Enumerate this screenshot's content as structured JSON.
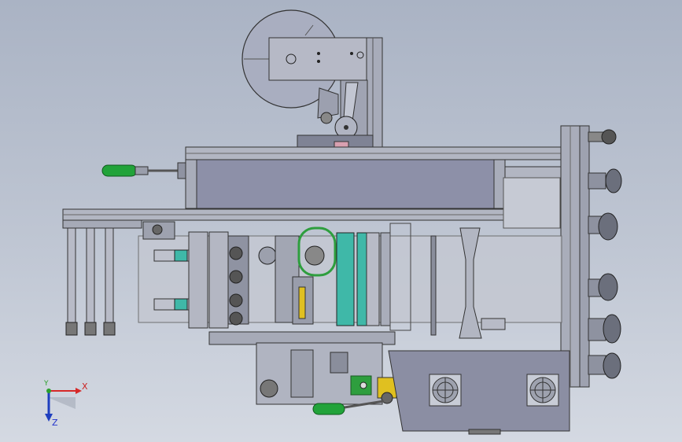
{
  "triad": {
    "x_label": "X",
    "y_label": "Y",
    "z_label": "Z",
    "x_color": "#d62828",
    "y_color": "#2ca02c",
    "z_color": "#1f3fbf"
  },
  "colors": {
    "background_top": "#aab3c4",
    "background_bottom": "#d4d9e2",
    "frame_gray": "#9aa0ac",
    "panel_dark": "#8c8fa6",
    "handle_green": "#22a33a",
    "roller_teal": "#3fb8a8",
    "accent_yellow": "#e0c020",
    "belt_green": "#2e9e3e"
  },
  "icons": {
    "fan_left": "fan-grille-icon",
    "fan_right": "fan-grille-icon",
    "reel": "reel-disc-icon",
    "triad": "axis-triad-icon"
  }
}
